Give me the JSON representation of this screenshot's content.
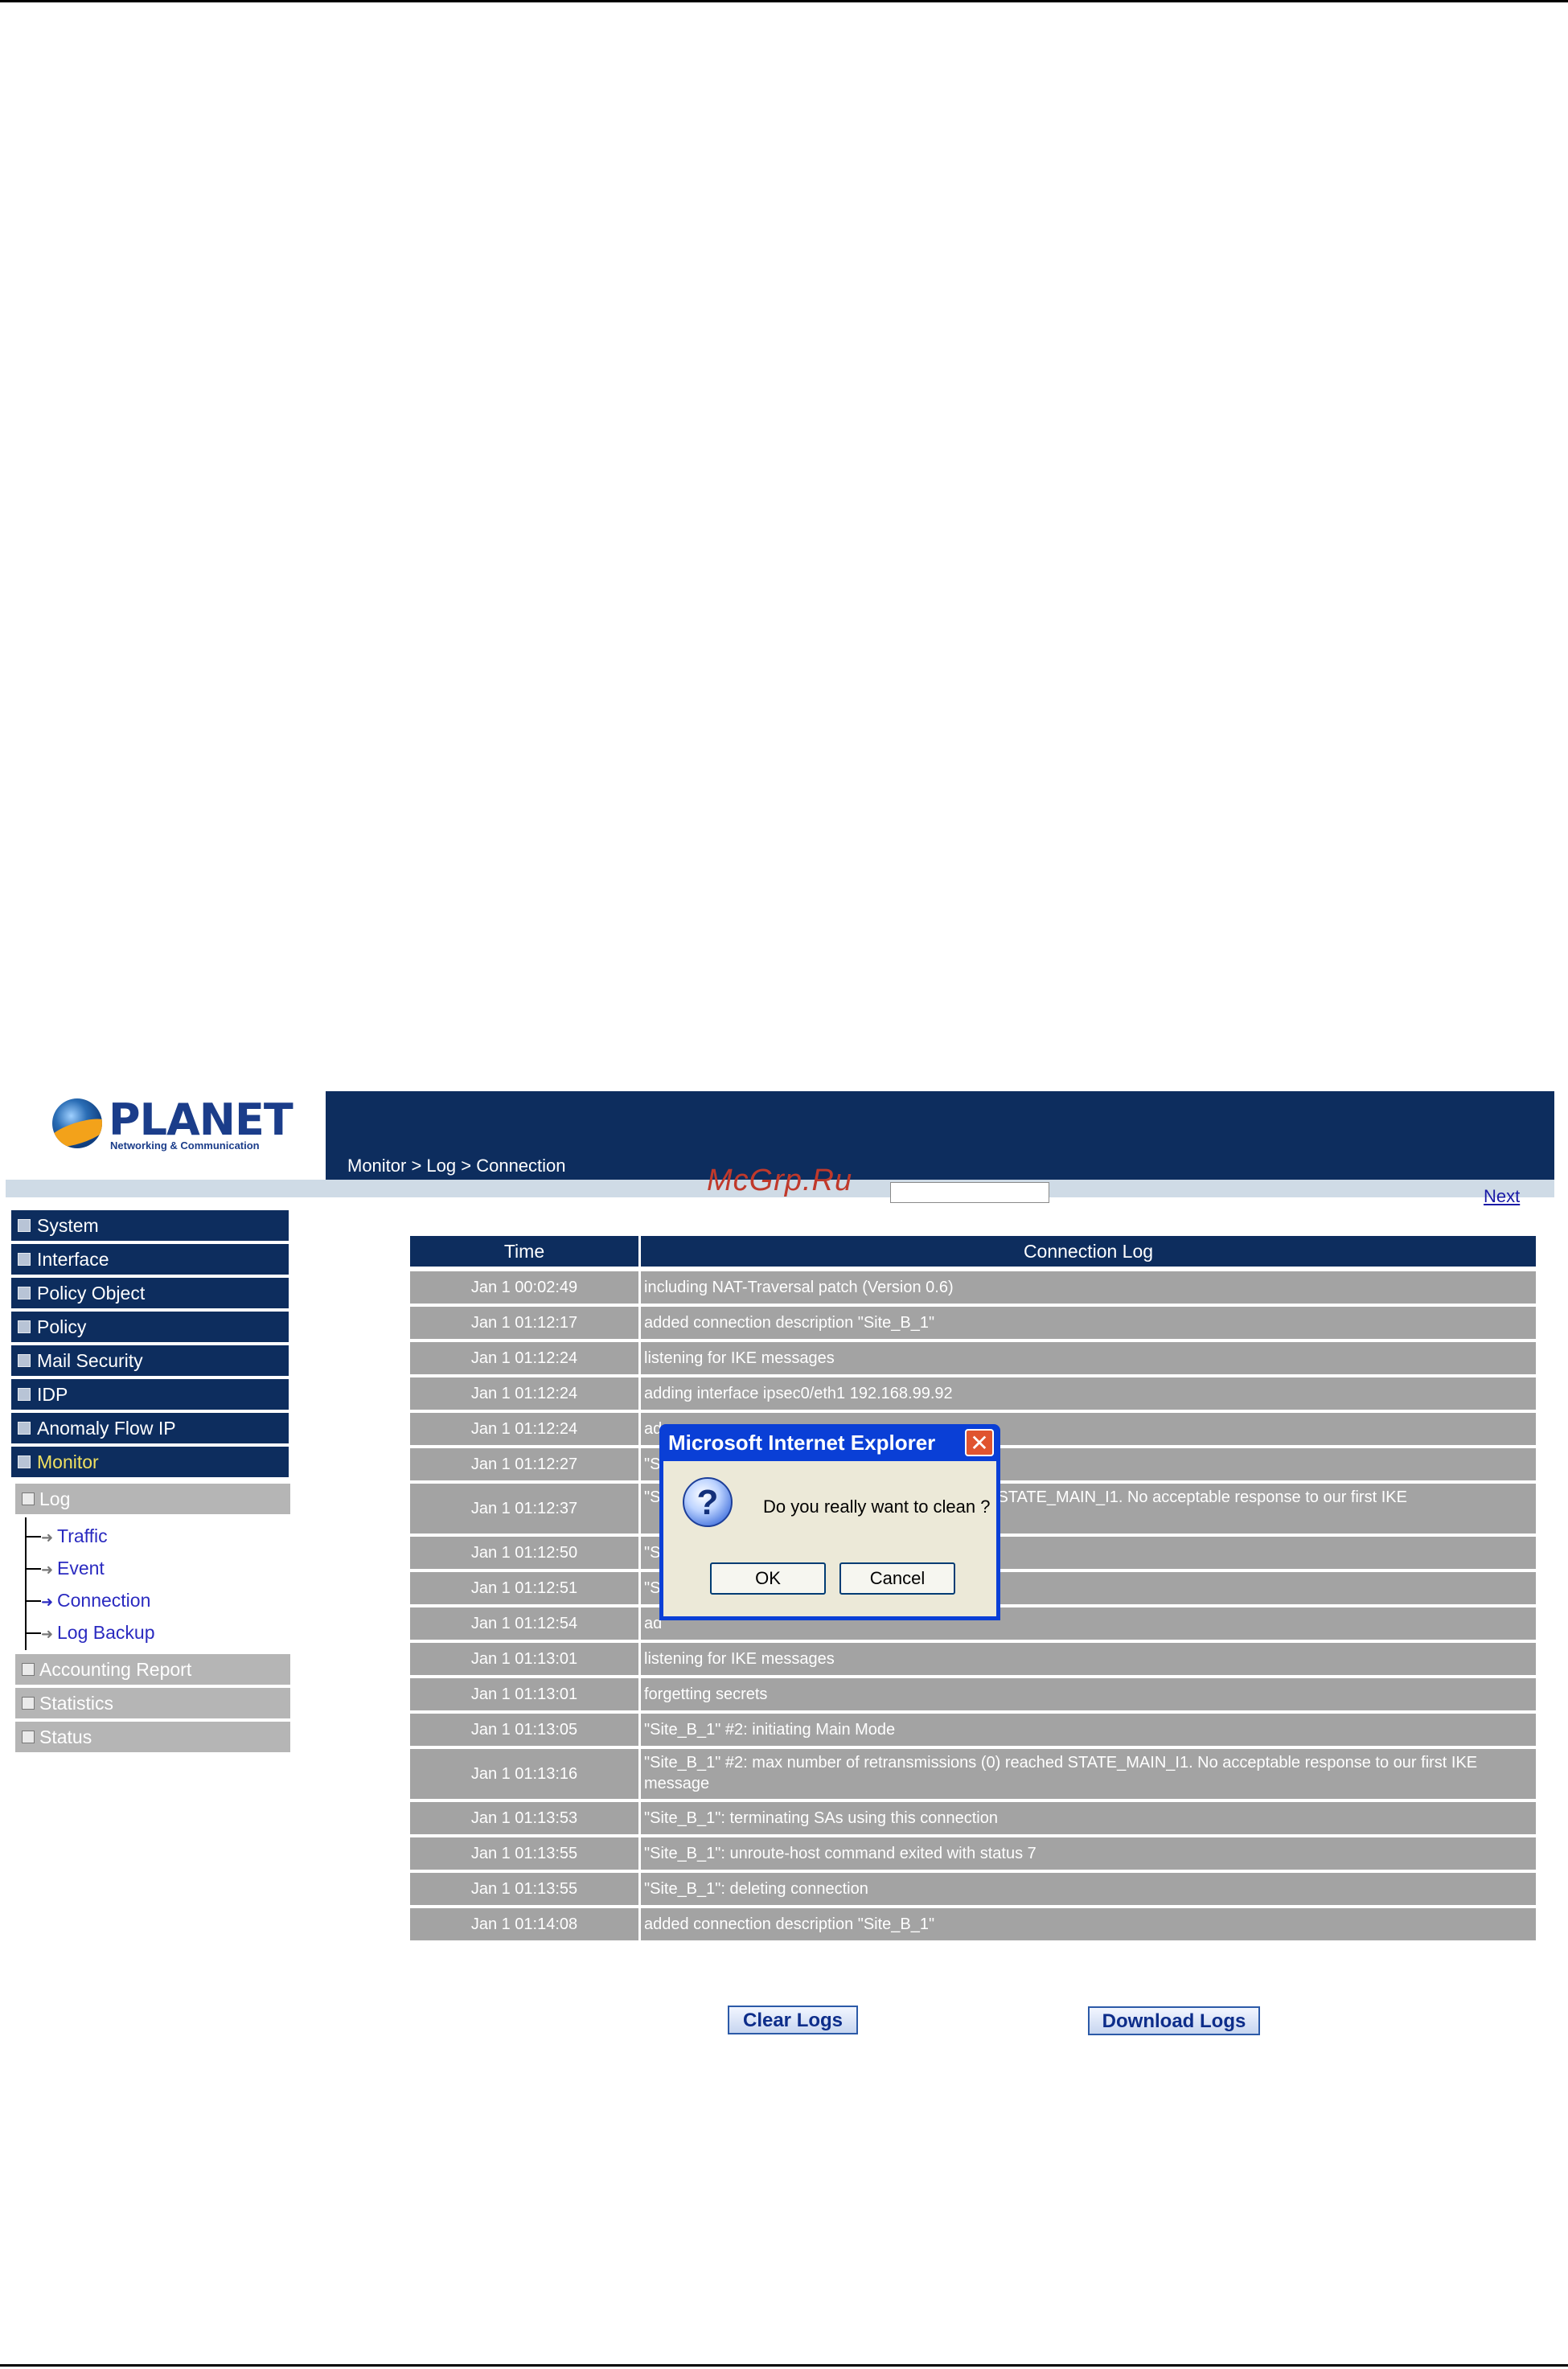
{
  "watermark": "McGrp.Ru",
  "logo": {
    "name": "PLANET",
    "tagline": "Networking & Communication"
  },
  "header": {
    "breadcrumb": "Monitor > Log > Connection"
  },
  "pager": {
    "next_label": "Next"
  },
  "sidebar": {
    "items": [
      {
        "label": "System"
      },
      {
        "label": "Interface"
      },
      {
        "label": "Policy Object"
      },
      {
        "label": "Policy"
      },
      {
        "label": "Mail Security"
      },
      {
        "label": "IDP"
      },
      {
        "label": "Anomaly Flow IP"
      },
      {
        "label": "Monitor"
      }
    ],
    "log_group": {
      "label": "Log",
      "links": [
        "Traffic",
        "Event",
        "Connection",
        "Log Backup"
      ]
    },
    "lower_items": [
      {
        "label": "Accounting Report"
      },
      {
        "label": "Statistics"
      },
      {
        "label": "Status"
      }
    ]
  },
  "table": {
    "headers": [
      "Time",
      "Connection Log"
    ],
    "rows": [
      {
        "time": "Jan 1 00:02:49",
        "log": "including NAT-Traversal patch (Version 0.6)"
      },
      {
        "time": "Jan 1 01:12:17",
        "log": "added connection description \"Site_B_1\""
      },
      {
        "time": "Jan 1 01:12:24",
        "log": "listening for IKE messages"
      },
      {
        "time": "Jan 1 01:12:24",
        "log": "adding interface ipsec0/eth1 192.168.99.92"
      },
      {
        "time": "Jan 1 01:12:24",
        "log": "ad"
      },
      {
        "time": "Jan 1 01:12:27",
        "log": "\"S"
      },
      {
        "time": "Jan 1 01:12:37",
        "log": "\"S                                                        (0) reached STATE_MAIN_I1. No acceptable response to our first IKE"
      },
      {
        "time": "Jan 1 01:12:50",
        "log": "\"S                                                        status 7"
      },
      {
        "time": "Jan 1 01:12:51",
        "log": "\"S"
      },
      {
        "time": "Jan 1 01:12:54",
        "log": "ad"
      },
      {
        "time": "Jan 1 01:13:01",
        "log": "listening for IKE messages"
      },
      {
        "time": "Jan 1 01:13:01",
        "log": "forgetting secrets"
      },
      {
        "time": "Jan 1 01:13:05",
        "log": "\"Site_B_1\" #2: initiating Main Mode"
      },
      {
        "time": "Jan 1 01:13:16",
        "log": "\"Site_B_1\" #2: max number of retransmissions (0) reached STATE_MAIN_I1. No acceptable response to our first IKE message"
      },
      {
        "time": "Jan 1 01:13:53",
        "log": "\"Site_B_1\": terminating SAs using this connection"
      },
      {
        "time": "Jan 1 01:13:55",
        "log": "\"Site_B_1\": unroute-host command exited with status 7"
      },
      {
        "time": "Jan 1 01:13:55",
        "log": "\"Site_B_1\": deleting connection"
      },
      {
        "time": "Jan 1 01:14:08",
        "log": "added connection description \"Site_B_1\""
      }
    ]
  },
  "actions": {
    "clear_label": "Clear Logs",
    "download_label": "Download Logs"
  },
  "dialog": {
    "title": "Microsoft Internet Explorer",
    "message": "Do you really want to clean ?",
    "ok_label": "OK",
    "cancel_label": "Cancel",
    "close_glyph": "✕",
    "icon_glyph": "?"
  }
}
